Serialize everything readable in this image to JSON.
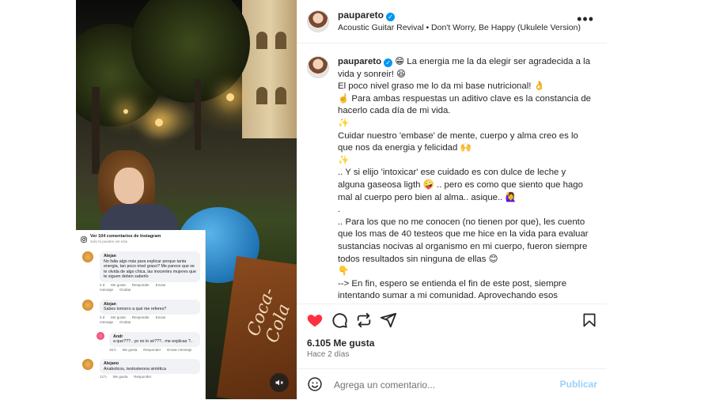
{
  "post": {
    "username": "paupareto",
    "audio": "Acoustic Guitar Revival • Don't Worry, Be Happy (Ukulele Version)",
    "more_icon": "more-horizontal-icon",
    "caption": " 😁 La energia me la da elegir ser agradecida a la vida y sonreir! 😆\nEl poco nivel graso me lo da mi base nutricional! 👌\n☝️ Para ambas respuestas un aditivo clave es la constancia de hacerlo cada día de mi vida.\n✨\nCuidar nuestro 'embase' de mente, cuerpo y alma creo es lo que nos da energia y felicidad 🙌\n✨\n.. Y si elijo 'intoxicar' ese cuidado es con dulce de leche y alguna gaseosa ligth 🤪 .. pero es como que siento que hago mal al cuerpo pero bien al alma.. asique.. 🙋‍♀️\n.\n.. Para los que no me conocen (no tienen por que), les cuento que los mas de 40 testeos que me hice en la vida para evaluar sustancias nocivas al organismo en mi cuerpo, fueron siempre todos resultados sin ninguna de ellas 😊\n👇\n--> En fin, espero se entienda el fin de este post, siempre intentando sumar a mi comunidad. Aprovechando esos comentarios que parecerían ofensivos, pero solo son la visión de alquien que se rodeó de otra realidad distinta a la de uno y no nos",
    "likes": "6.105 Me gusta",
    "time_ago": "Hace 2 días",
    "comment_placeholder": "Agrega un comentario...",
    "publish_label": "Publicar",
    "media_text": "Coca-Cola"
  },
  "embedded_comments": {
    "title": "Ver 104 comentarios de Instagram",
    "subtitle": "Solo tú puedes ver esto",
    "items": [
      {
        "name": "Alejan",
        "text": "No falta algo más para explicar porque tanta energia, tan poco nivel graso? Me parece que se te olvida de algo chica, las inocentes mujeres que te siguen deben saberlo",
        "meta": [
          "4 d",
          "Me gusta",
          "Responder",
          "Enviar mensaje",
          "Ocultar"
        ],
        "reply": false
      },
      {
        "name": "Alejan",
        "text": "Sabes tomorro a qué me referes?",
        "meta": [
          "3 d",
          "Me gusta",
          "Responder",
          "Enviar mensaje",
          "Ocultar"
        ],
        "reply": false
      },
      {
        "name": "Andr",
        "text": "a que???.. yo no lo sé???.. me explicas ?..",
        "meta": [
          "15 h",
          "Me gusta",
          "Responder",
          "Enviar mensaje"
        ],
        "reply": true
      },
      {
        "name": "Alejano",
        "text": "Anabolicos, testosterona sintética",
        "meta": [
          "12 h",
          "Me gusta",
          "Responder"
        ],
        "reply": false
      }
    ]
  }
}
